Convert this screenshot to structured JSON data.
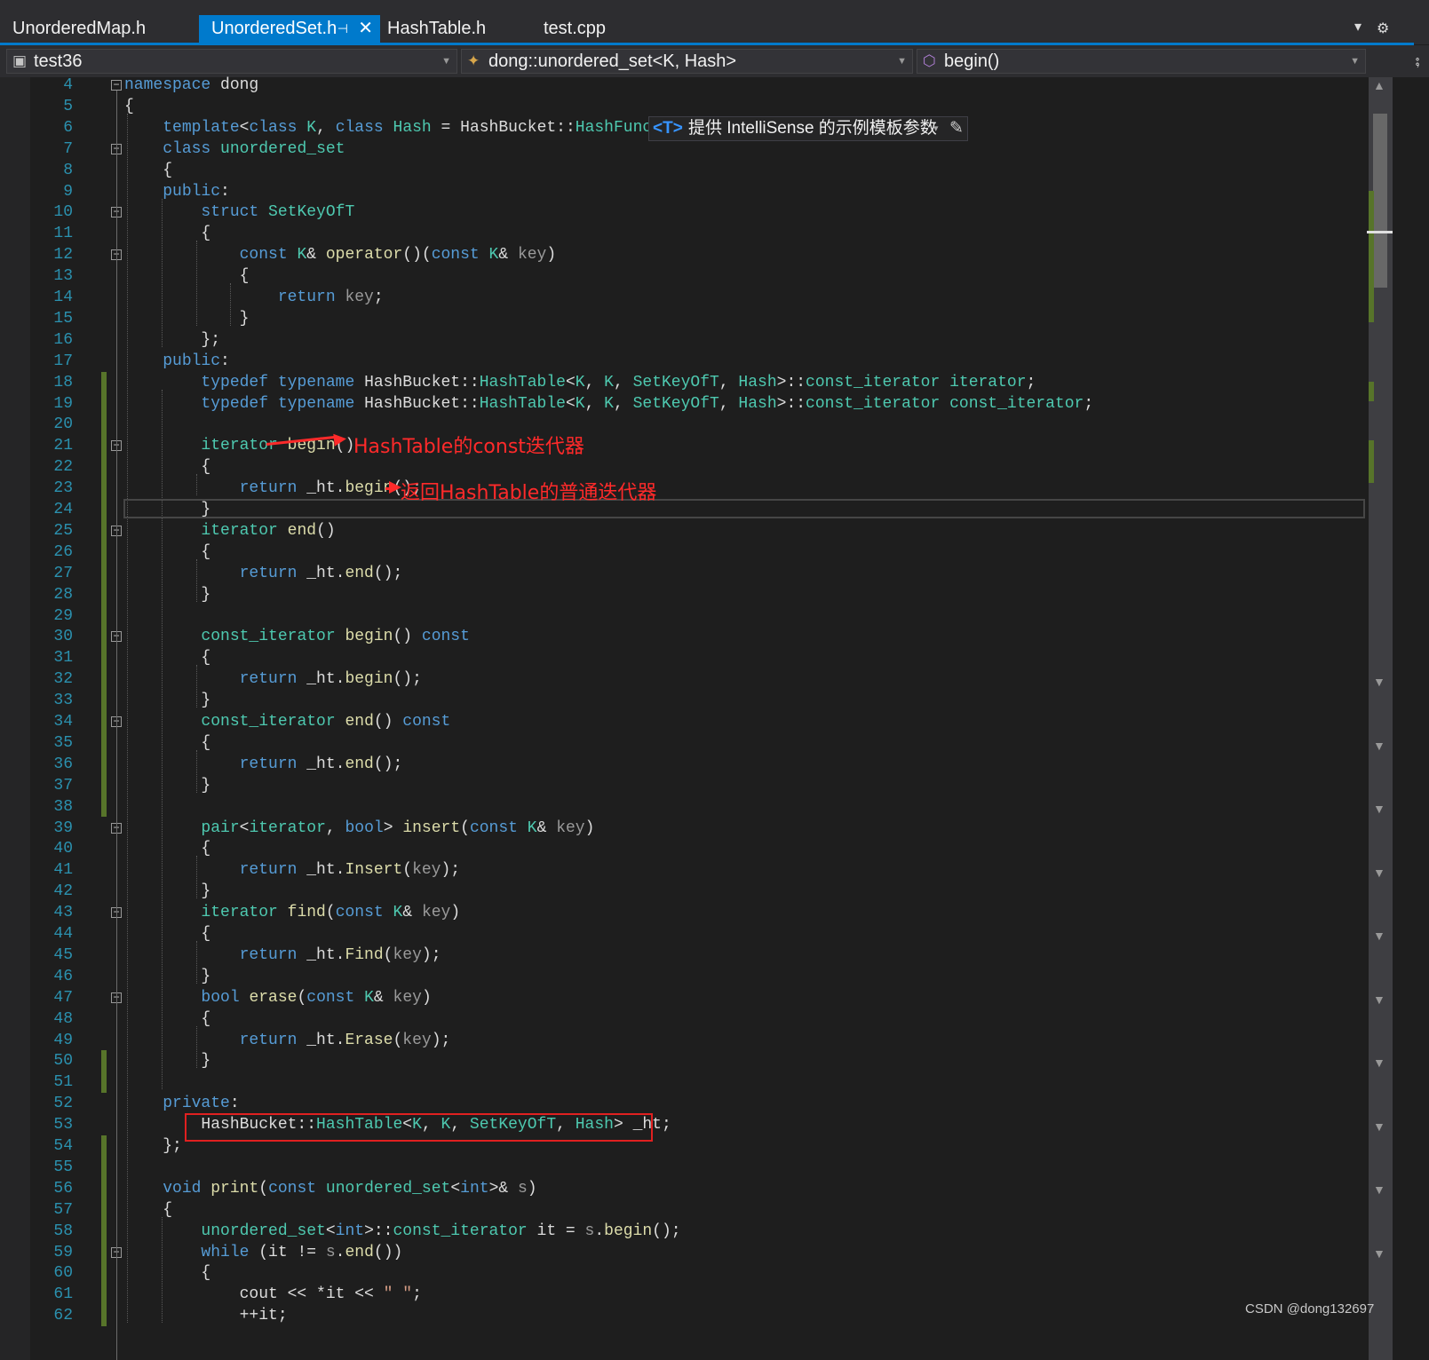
{
  "tabs": [
    {
      "label": "UnorderedMap.h",
      "active": false
    },
    {
      "label": "UnorderedSet.h",
      "active": true,
      "pin": "⊣",
      "close": "✕"
    },
    {
      "label": "HashTable.h",
      "active": false
    },
    {
      "label": "test.cpp",
      "active": false
    }
  ],
  "tabbar_controls": {
    "dropdown": "▾",
    "settings": "⚙"
  },
  "nav": {
    "project": "test36",
    "scope": "dong::unordered_set<K, Hash>",
    "member": "begin()",
    "project_icon": "project-icon",
    "scope_icon": "class-icon",
    "member_icon": "method-icon"
  },
  "intellisense_hint": {
    "badge": "<T>",
    "text": "提供 IntelliSense 的示例模板参数",
    "dropdown": "▾",
    "edit": "✎"
  },
  "annotations": {
    "begin_note": "HashTable的const迭代器",
    "return_note": "返回HashTable的普通迭代器"
  },
  "watermark": "CSDN @dong132697",
  "colors": {
    "keyword": "#569cd6",
    "type": "#4ec9b0",
    "function": "#dcdcaa",
    "param": "#9a9a9a",
    "string": "#d69d85",
    "linenum": "#2b91af",
    "annotation": "#ff2a2a",
    "accent": "#007acc",
    "changebar": "#57742a"
  },
  "code": {
    "first_line": 4,
    "lines": [
      [
        [
          "kw",
          "namespace"
        ],
        [
          "",
          " dong"
        ]
      ],
      [
        [
          "",
          "{"
        ]
      ],
      [
        [
          "",
          "    "
        ],
        [
          "kw",
          "template"
        ],
        [
          "",
          "<"
        ],
        [
          "kw",
          "class"
        ],
        [
          "",
          " "
        ],
        [
          "ty",
          "K"
        ],
        [
          "",
          ", "
        ],
        [
          "kw",
          "class"
        ],
        [
          "",
          " "
        ],
        [
          "ty",
          "Hash"
        ],
        [
          "",
          " = HashBucket::"
        ],
        [
          "ty",
          "HashFunc"
        ],
        [
          "",
          "<"
        ],
        [
          "ty",
          "K"
        ],
        [
          "",
          ">>"
        ]
      ],
      [
        [
          "",
          "    "
        ],
        [
          "kw",
          "class"
        ],
        [
          "",
          " "
        ],
        [
          "ty",
          "unordered_set"
        ]
      ],
      [
        [
          "",
          "    {"
        ]
      ],
      [
        [
          "",
          "    "
        ],
        [
          "kw",
          "public"
        ],
        [
          "",
          ":"
        ]
      ],
      [
        [
          "",
          "        "
        ],
        [
          "kw",
          "struct"
        ],
        [
          "",
          " "
        ],
        [
          "ty",
          "SetKeyOfT"
        ]
      ],
      [
        [
          "",
          "        {"
        ]
      ],
      [
        [
          "",
          "            "
        ],
        [
          "kw",
          "const"
        ],
        [
          "",
          " "
        ],
        [
          "ty",
          "K"
        ],
        [
          "",
          "& "
        ],
        [
          "fn",
          "operator"
        ],
        [
          "",
          "()("
        ],
        [
          "kw",
          "const"
        ],
        [
          "",
          " "
        ],
        [
          "ty",
          "K"
        ],
        [
          "",
          "& "
        ],
        [
          "pa",
          "key"
        ],
        [
          "",
          ")"
        ]
      ],
      [
        [
          "",
          "            {"
        ]
      ],
      [
        [
          "",
          "                "
        ],
        [
          "kw",
          "return"
        ],
        [
          "",
          " "
        ],
        [
          "pa",
          "key"
        ],
        [
          "",
          ";"
        ]
      ],
      [
        [
          "",
          "            }"
        ]
      ],
      [
        [
          "",
          "        };"
        ]
      ],
      [
        [
          "",
          "    "
        ],
        [
          "kw",
          "public"
        ],
        [
          "",
          ":"
        ]
      ],
      [
        [
          "",
          "        "
        ],
        [
          "kw",
          "typedef"
        ],
        [
          "",
          " "
        ],
        [
          "kw",
          "typename"
        ],
        [
          "",
          " HashBucket::"
        ],
        [
          "ty",
          "HashTable"
        ],
        [
          "",
          "<"
        ],
        [
          "ty",
          "K"
        ],
        [
          "",
          ", "
        ],
        [
          "ty",
          "K"
        ],
        [
          "",
          ", "
        ],
        [
          "ty",
          "SetKeyOfT"
        ],
        [
          "",
          ", "
        ],
        [
          "ty",
          "Hash"
        ],
        [
          "",
          ">::"
        ],
        [
          "ty",
          "const_iterator"
        ],
        [
          "",
          " "
        ],
        [
          "ty",
          "iterator"
        ],
        [
          "",
          ";"
        ]
      ],
      [
        [
          "",
          "        "
        ],
        [
          "kw",
          "typedef"
        ],
        [
          "",
          " "
        ],
        [
          "kw",
          "typename"
        ],
        [
          "",
          " HashBucket::"
        ],
        [
          "ty",
          "HashTable"
        ],
        [
          "",
          "<"
        ],
        [
          "ty",
          "K"
        ],
        [
          "",
          ", "
        ],
        [
          "ty",
          "K"
        ],
        [
          "",
          ", "
        ],
        [
          "ty",
          "SetKeyOfT"
        ],
        [
          "",
          ", "
        ],
        [
          "ty",
          "Hash"
        ],
        [
          "",
          ">::"
        ],
        [
          "ty",
          "const_iterator"
        ],
        [
          "",
          " "
        ],
        [
          "ty",
          "const_iterator"
        ],
        [
          "",
          ";"
        ]
      ],
      [
        [
          "",
          ""
        ]
      ],
      [
        [
          "",
          "        "
        ],
        [
          "ty",
          "iterator"
        ],
        [
          "",
          " "
        ],
        [
          "fn",
          "begin"
        ],
        [
          "",
          "()"
        ]
      ],
      [
        [
          "",
          "        {"
        ]
      ],
      [
        [
          "",
          "            "
        ],
        [
          "kw",
          "return"
        ],
        [
          "",
          " _ht."
        ],
        [
          "fn",
          "begin"
        ],
        [
          "",
          "();"
        ]
      ],
      [
        [
          "",
          "        }"
        ]
      ],
      [
        [
          "",
          "        "
        ],
        [
          "ty",
          "iterator"
        ],
        [
          "",
          " "
        ],
        [
          "fn",
          "end"
        ],
        [
          "",
          "()"
        ]
      ],
      [
        [
          "",
          "        {"
        ]
      ],
      [
        [
          "",
          "            "
        ],
        [
          "kw",
          "return"
        ],
        [
          "",
          " _ht."
        ],
        [
          "fn",
          "end"
        ],
        [
          "",
          "();"
        ]
      ],
      [
        [
          "",
          "        }"
        ]
      ],
      [
        [
          "",
          ""
        ]
      ],
      [
        [
          "",
          "        "
        ],
        [
          "ty",
          "const_iterator"
        ],
        [
          "",
          " "
        ],
        [
          "fn",
          "begin"
        ],
        [
          "",
          "() "
        ],
        [
          "kw",
          "const"
        ]
      ],
      [
        [
          "",
          "        {"
        ]
      ],
      [
        [
          "",
          "            "
        ],
        [
          "kw",
          "return"
        ],
        [
          "",
          " _ht."
        ],
        [
          "fn",
          "begin"
        ],
        [
          "",
          "();"
        ]
      ],
      [
        [
          "",
          "        }"
        ]
      ],
      [
        [
          "",
          "        "
        ],
        [
          "ty",
          "const_iterator"
        ],
        [
          "",
          " "
        ],
        [
          "fn",
          "end"
        ],
        [
          "",
          "() "
        ],
        [
          "kw",
          "const"
        ]
      ],
      [
        [
          "",
          "        {"
        ]
      ],
      [
        [
          "",
          "            "
        ],
        [
          "kw",
          "return"
        ],
        [
          "",
          " _ht."
        ],
        [
          "fn",
          "end"
        ],
        [
          "",
          "();"
        ]
      ],
      [
        [
          "",
          "        }"
        ]
      ],
      [
        [
          "",
          ""
        ]
      ],
      [
        [
          "",
          "        "
        ],
        [
          "ty",
          "pair"
        ],
        [
          "",
          "<"
        ],
        [
          "ty",
          "iterator"
        ],
        [
          "",
          ", "
        ],
        [
          "kw",
          "bool"
        ],
        [
          "",
          "> "
        ],
        [
          "fn",
          "insert"
        ],
        [
          "",
          "("
        ],
        [
          "kw",
          "const"
        ],
        [
          "",
          " "
        ],
        [
          "ty",
          "K"
        ],
        [
          "",
          "& "
        ],
        [
          "pa",
          "key"
        ],
        [
          "",
          ")"
        ]
      ],
      [
        [
          "",
          "        {"
        ]
      ],
      [
        [
          "",
          "            "
        ],
        [
          "kw",
          "return"
        ],
        [
          "",
          " _ht."
        ],
        [
          "fn",
          "Insert"
        ],
        [
          "",
          "("
        ],
        [
          "pa",
          "key"
        ],
        [
          "",
          ");"
        ]
      ],
      [
        [
          "",
          "        }"
        ]
      ],
      [
        [
          "",
          "        "
        ],
        [
          "ty",
          "iterator"
        ],
        [
          "",
          " "
        ],
        [
          "fn",
          "find"
        ],
        [
          "",
          "("
        ],
        [
          "kw",
          "const"
        ],
        [
          "",
          " "
        ],
        [
          "ty",
          "K"
        ],
        [
          "",
          "& "
        ],
        [
          "pa",
          "key"
        ],
        [
          "",
          ")"
        ]
      ],
      [
        [
          "",
          "        {"
        ]
      ],
      [
        [
          "",
          "            "
        ],
        [
          "kw",
          "return"
        ],
        [
          "",
          " _ht."
        ],
        [
          "fn",
          "Find"
        ],
        [
          "",
          "("
        ],
        [
          "pa",
          "key"
        ],
        [
          "",
          ");"
        ]
      ],
      [
        [
          "",
          "        }"
        ]
      ],
      [
        [
          "",
          "        "
        ],
        [
          "kw",
          "bool"
        ],
        [
          "",
          " "
        ],
        [
          "fn",
          "erase"
        ],
        [
          "",
          "("
        ],
        [
          "kw",
          "const"
        ],
        [
          "",
          " "
        ],
        [
          "ty",
          "K"
        ],
        [
          "",
          "& "
        ],
        [
          "pa",
          "key"
        ],
        [
          "",
          ")"
        ]
      ],
      [
        [
          "",
          "        {"
        ]
      ],
      [
        [
          "",
          "            "
        ],
        [
          "kw",
          "return"
        ],
        [
          "",
          " _ht."
        ],
        [
          "fn",
          "Erase"
        ],
        [
          "",
          "("
        ],
        [
          "pa",
          "key"
        ],
        [
          "",
          ");"
        ]
      ],
      [
        [
          "",
          "        }"
        ]
      ],
      [
        [
          "",
          ""
        ]
      ],
      [
        [
          "",
          "    "
        ],
        [
          "kw",
          "private"
        ],
        [
          "",
          ":"
        ]
      ],
      [
        [
          "",
          "        HashBucket::"
        ],
        [
          "ty",
          "HashTable"
        ],
        [
          "",
          "<"
        ],
        [
          "ty",
          "K"
        ],
        [
          "",
          ", "
        ],
        [
          "ty",
          "K"
        ],
        [
          "",
          ", "
        ],
        [
          "ty",
          "SetKeyOfT"
        ],
        [
          "",
          ", "
        ],
        [
          "ty",
          "Hash"
        ],
        [
          "",
          "> _ht;"
        ]
      ],
      [
        [
          "",
          "    };"
        ]
      ],
      [
        [
          "",
          ""
        ]
      ],
      [
        [
          "",
          "    "
        ],
        [
          "kw",
          "void"
        ],
        [
          "",
          " "
        ],
        [
          "fn",
          "print"
        ],
        [
          "",
          "("
        ],
        [
          "kw",
          "const"
        ],
        [
          "",
          " "
        ],
        [
          "ty",
          "unordered_set"
        ],
        [
          "",
          "<"
        ],
        [
          "kw",
          "int"
        ],
        [
          "",
          ">& "
        ],
        [
          "pa",
          "s"
        ],
        [
          "",
          ")"
        ]
      ],
      [
        [
          "",
          "    {"
        ]
      ],
      [
        [
          "",
          "        "
        ],
        [
          "ty",
          "unordered_set"
        ],
        [
          "",
          "<"
        ],
        [
          "kw",
          "int"
        ],
        [
          "",
          ">::"
        ],
        [
          "ty",
          "const_iterator"
        ],
        [
          "",
          " it = "
        ],
        [
          "pa",
          "s"
        ],
        [
          "",
          "."
        ],
        [
          "fn",
          "begin"
        ],
        [
          "",
          "();"
        ]
      ],
      [
        [
          "",
          "        "
        ],
        [
          "kw",
          "while"
        ],
        [
          "",
          " (it != "
        ],
        [
          "pa",
          "s"
        ],
        [
          "",
          "."
        ],
        [
          "fn",
          "end"
        ],
        [
          "",
          "())"
        ]
      ],
      [
        [
          "",
          "        {"
        ]
      ],
      [
        [
          "",
          "            cout << *it << "
        ],
        [
          "st",
          "\" \""
        ],
        [
          "",
          ";"
        ]
      ],
      [
        [
          "",
          "            ++it;"
        ]
      ]
    ]
  },
  "fold_lines": [
    4,
    7,
    10,
    12,
    21,
    25,
    30,
    34,
    39,
    43,
    47,
    59
  ]
}
